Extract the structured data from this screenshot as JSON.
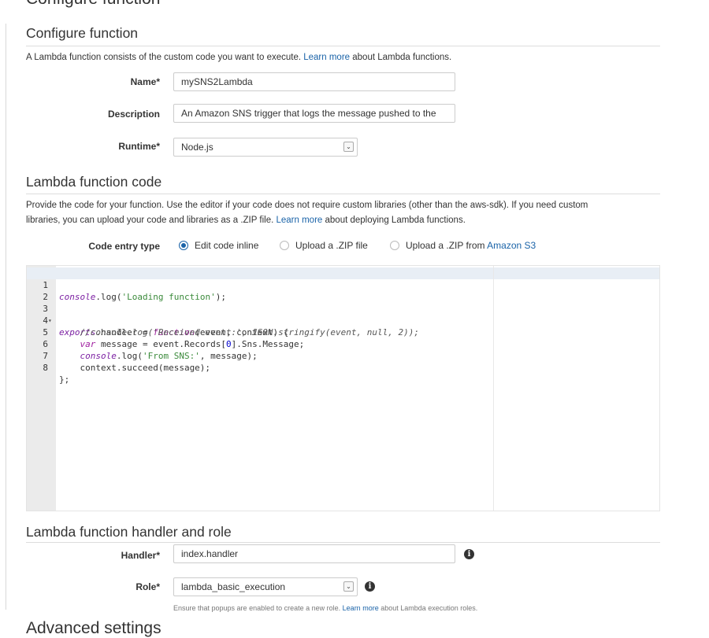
{
  "page": {
    "heading_partial": "Configure function",
    "bottom_partial": "Advanced settings"
  },
  "configure": {
    "title": "Configure function",
    "intro_text": "A Lambda function consists of the custom code you want to execute.",
    "intro_link": "Learn more",
    "intro_suffix": "about Lambda functions.",
    "name_label": "Name*",
    "name_value": "mySNS2Lambda",
    "description_label": "Description",
    "description_value": "An Amazon SNS trigger that logs the message pushed to the",
    "runtime_label": "Runtime*",
    "runtime_value": "Node.js"
  },
  "code_section": {
    "title": "Lambda function code",
    "desc_line1": "Provide the code for your function. Use the editor if your code does not require custom libraries (other than the aws-sdk). If you need custom",
    "desc_line2_prefix": "libraries, you can upload your code and libraries as a .ZIP file.",
    "desc_link": "Learn more",
    "desc_line2_suffix": "about deploying Lambda functions.",
    "entry_type_label": "Code entry type",
    "options": [
      "Edit code inline",
      "Upload a .ZIP file",
      "Upload a .ZIP from"
    ],
    "s3_link": "Amazon S3",
    "selected_option": "Edit code inline"
  },
  "editor": {
    "lines": [
      {
        "n": "1",
        "fold": ""
      },
      {
        "n": "2",
        "fold": ""
      },
      {
        "n": "3",
        "fold": "▾"
      },
      {
        "n": "4",
        "fold": ""
      },
      {
        "n": "5",
        "fold": ""
      },
      {
        "n": "6",
        "fold": ""
      },
      {
        "n": "7",
        "fold": ""
      },
      {
        "n": "8",
        "fold": ""
      }
    ],
    "code": {
      "l1_fn": "console",
      "l1_rest": ".log(",
      "l1_str": "'Loading function'",
      "l1_end": ");",
      "l3_a": "exports",
      "l3_b": ".handler = ",
      "l3_kw": "function",
      "l3_c": "(event, context) {",
      "l4": "    //console.log('Received event:', JSON.stringify(event, null, 2));",
      "l5_ind": "    ",
      "l5_kw": "var",
      "l5_a": " message = event.Records[",
      "l5_num": "0",
      "l5_b": "].Sns.Message;",
      "l6_ind": "    ",
      "l6_fn": "console",
      "l6_a": ".log(",
      "l6_str": "'From SNS:'",
      "l6_b": ", message);",
      "l7": "    context.succeed(message);",
      "l8": "};"
    }
  },
  "handler_section": {
    "title": "Lambda function handler and role",
    "handler_label": "Handler*",
    "handler_value": "index.handler",
    "role_label": "Role*",
    "role_value": "lambda_basic_execution",
    "hint_prefix": "Ensure that popups are enabled to create a new role.",
    "hint_link": "Learn more",
    "hint_suffix": "about Lambda execution roles."
  },
  "icons": {
    "info": "info-icon",
    "dropdown": "chevron-down-icon"
  },
  "colors": {
    "link": "#1a63a8",
    "active_line": "#e8eef5",
    "gutter": "#ebebeb"
  }
}
